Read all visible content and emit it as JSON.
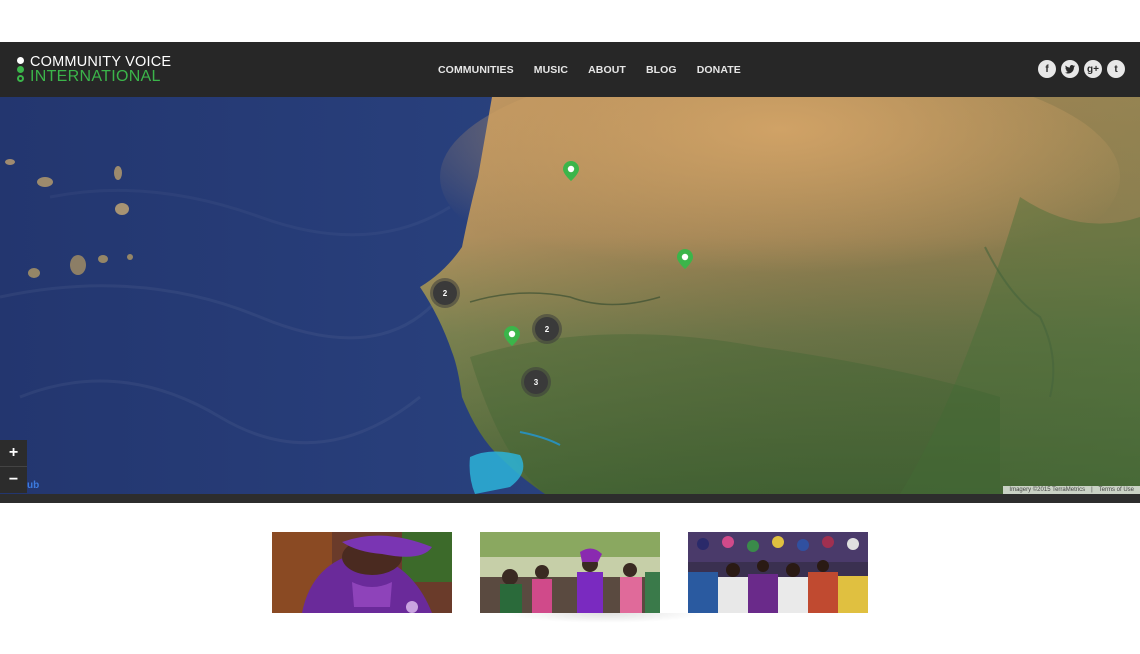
{
  "brand": {
    "line1": "COMMUNITY VOICE",
    "line2": "INTERNATIONAL",
    "accent_color": "#3bb54a"
  },
  "nav": {
    "items": [
      {
        "label": "COMMUNITIES"
      },
      {
        "label": "MUSIC"
      },
      {
        "label": "ABOUT"
      },
      {
        "label": "BLOG"
      },
      {
        "label": "DONATE"
      }
    ]
  },
  "social": {
    "icons": [
      {
        "name": "facebook-icon",
        "glyph": "f"
      },
      {
        "name": "twitter-icon",
        "glyph": "t"
      },
      {
        "name": "google-plus-icon",
        "glyph": "g+"
      },
      {
        "name": "tumblr-icon",
        "glyph": "t"
      }
    ]
  },
  "map": {
    "clusters": [
      {
        "count": "2"
      },
      {
        "count": "2"
      },
      {
        "count": "3"
      }
    ],
    "zoom_in": "+",
    "zoom_out": "−",
    "provider_logo": "ub",
    "attribution": "Imagery ©2015 TerraMetrics",
    "terms": "Terms of Use",
    "marker_color": "#3bb54a"
  },
  "gallery": {
    "items": [
      {
        "name": "woman-in-purple-photo"
      },
      {
        "name": "group-of-women-photo"
      },
      {
        "name": "seated-crowd-photo"
      }
    ]
  }
}
